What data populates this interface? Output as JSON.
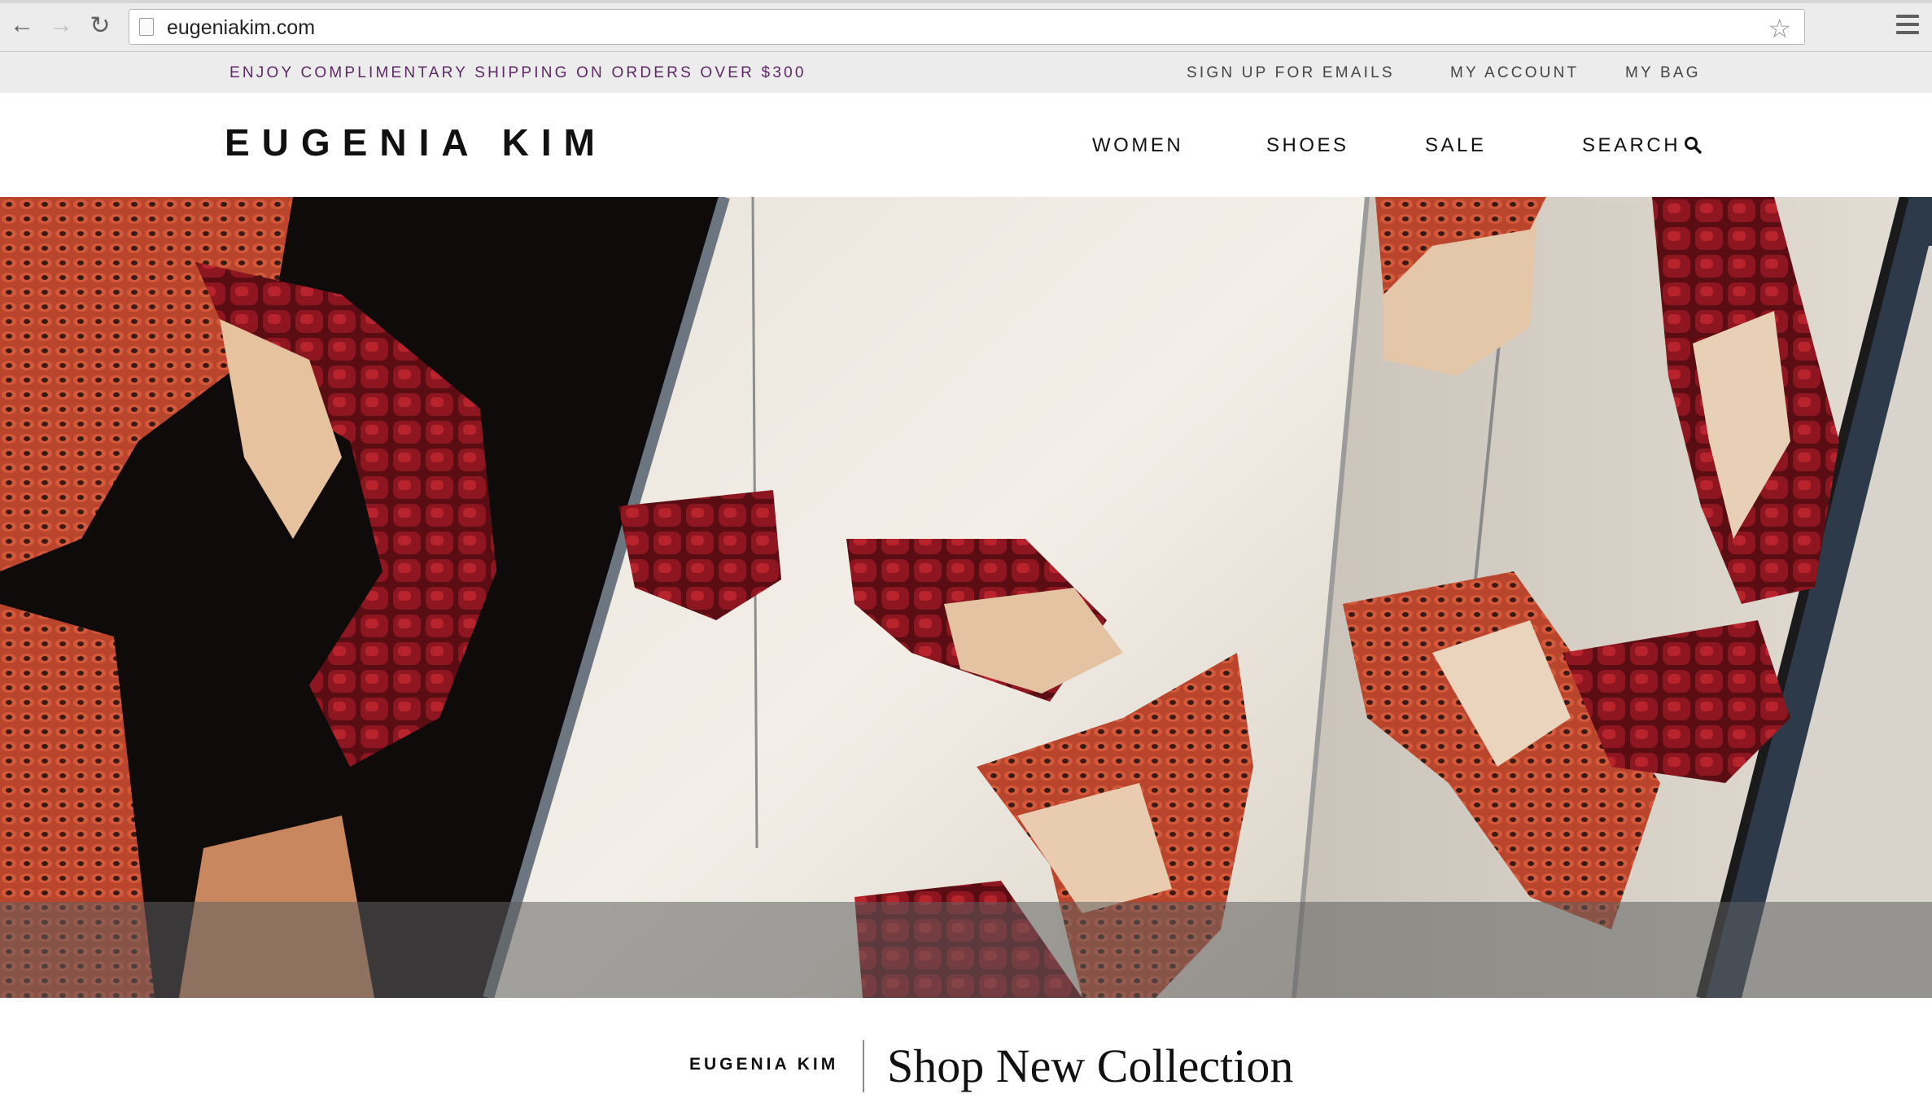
{
  "browser": {
    "url": "eugeniakim.com",
    "back_icon": "arrow-left-icon",
    "forward_icon": "arrow-right-icon",
    "reload_icon": "reload-icon",
    "bookmark_icon": "star-icon",
    "menu_icon": "hamburger-icon"
  },
  "utility_bar": {
    "promo": "ENJOY COMPLIMENTARY SHIPPING ON ORDERS OVER $300",
    "links": [
      "SIGN UP FOR EMAILS",
      "MY ACCOUNT",
      "MY BAG"
    ],
    "promo_color": "#5e2867"
  },
  "header": {
    "logo": "EUGENIA KIM",
    "nav": [
      "WOMEN",
      "SHOES",
      "SALE",
      "SEARCH"
    ],
    "search_icon": "magnifier-icon"
  },
  "hero": {
    "image": "red snakeskin strappy heeled sandals on white sheepskin with mirrored panels"
  },
  "cta": {
    "brand": "EUGENIA KIM",
    "text": "Shop New Collection"
  },
  "colors": {
    "utility_bg": "#ececec",
    "text": "#111111"
  }
}
